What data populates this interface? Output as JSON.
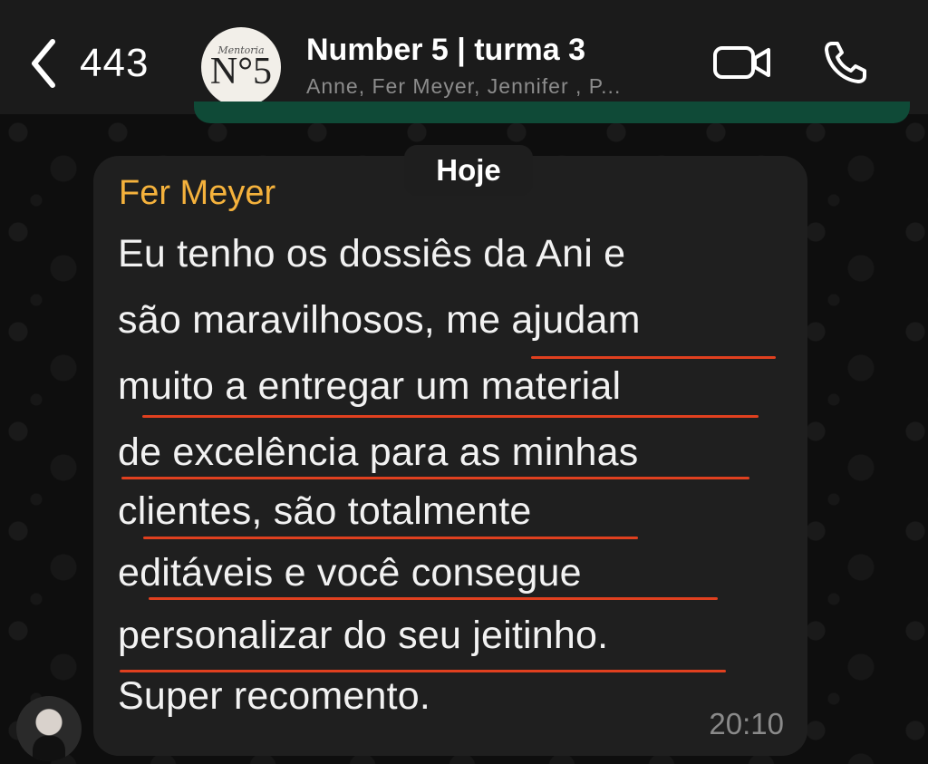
{
  "header": {
    "back_count": "443",
    "avatar_small_text": "Mentoria",
    "avatar_main_text": "N°5",
    "title": "Number 5 | turma 3",
    "subtitle": "Anne, Fer Meyer, Jennifer , P..."
  },
  "chat": {
    "date_label": "Hoje",
    "message": {
      "sender": "Fer Meyer",
      "lines": [
        "Eu tenho os dossiês da Ani e",
        "são maravilhosos, me ajudam",
        "muito a entregar um material",
        "de excelência para as minhas",
        "clientes, são totalmente",
        "editáveis e você consegue",
        "personalizar do seu jeitinho.",
        "Super recomento."
      ],
      "time": "20:10"
    }
  },
  "colors": {
    "sender_name": "#f5b23c",
    "underline": "#e0401f",
    "bubble": "#1f1f1f",
    "outgoing_bubble": "#0f4a37"
  },
  "icons": {
    "back": "chevron-left-icon",
    "video": "video-camera-icon",
    "phone": "phone-icon"
  }
}
